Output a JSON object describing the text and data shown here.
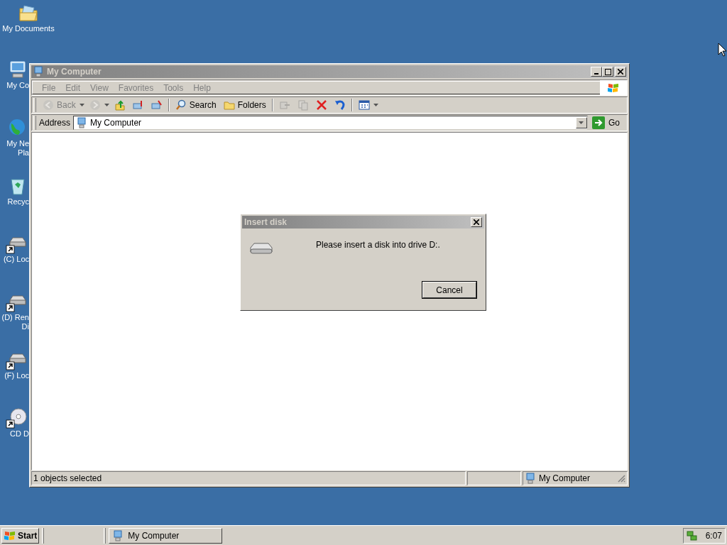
{
  "desktop_icons": [
    {
      "kind": "documents",
      "lines": [
        "My Documents"
      ],
      "shortcut": false
    },
    {
      "kind": "computer",
      "lines": [
        "My Co"
      ],
      "shortcut": false
    },
    {
      "kind": "network",
      "lines": [
        "My Ne",
        "Pla"
      ],
      "shortcut": false
    },
    {
      "kind": "recycle",
      "lines": [
        "Recyc"
      ],
      "shortcut": false
    },
    {
      "kind": "drive",
      "lines": [
        "(C) Loc"
      ],
      "shortcut": true
    },
    {
      "kind": "drive",
      "lines": [
        "(D) Ren",
        "Di"
      ],
      "shortcut": true
    },
    {
      "kind": "drive",
      "lines": [
        "(F) Loc"
      ],
      "shortcut": true
    },
    {
      "kind": "cd",
      "lines": [
        "CD D"
      ],
      "shortcut": true
    }
  ],
  "window": {
    "title": "My Computer",
    "active": false,
    "menu": [
      {
        "label": "File",
        "disabled": true
      },
      {
        "label": "Edit",
        "disabled": true
      },
      {
        "label": "View",
        "disabled": true
      },
      {
        "label": "Favorites",
        "disabled": true
      },
      {
        "label": "Tools",
        "disabled": true
      },
      {
        "label": "Help",
        "disabled": true
      }
    ],
    "toolbar": [
      [
        {
          "kind": "back",
          "label": "Back",
          "caret": true,
          "disabled": true
        },
        {
          "kind": "forward",
          "caret": true,
          "disabled": true
        },
        {
          "kind": "up",
          "disabled": false
        },
        {
          "kind": "map-drive",
          "disabled": false
        },
        {
          "kind": "disconnect",
          "disabled": false
        }
      ],
      [
        {
          "kind": "search",
          "label": "Search",
          "disabled": false
        },
        {
          "kind": "folders",
          "label": "Folders",
          "disabled": false
        }
      ],
      [
        {
          "kind": "move",
          "disabled": true
        },
        {
          "kind": "copy",
          "disabled": true
        },
        {
          "kind": "delete",
          "disabled": false
        },
        {
          "kind": "undo",
          "disabled": false
        }
      ],
      [
        {
          "kind": "views",
          "caret": true,
          "disabled": false
        }
      ]
    ],
    "address": {
      "label": "Address",
      "value": "My Computer",
      "go": "Go"
    },
    "status_bar": {
      "text": "1 objects selected",
      "location": "My Computer"
    }
  },
  "dialog": {
    "title": "Insert disk",
    "active": false,
    "message": "Please insert a disk into drive D:.",
    "button": "Cancel"
  },
  "taskbar": {
    "start": "Start",
    "tasks": [
      {
        "label": "My Computer",
        "selected": false
      }
    ],
    "clock": "6:07"
  }
}
